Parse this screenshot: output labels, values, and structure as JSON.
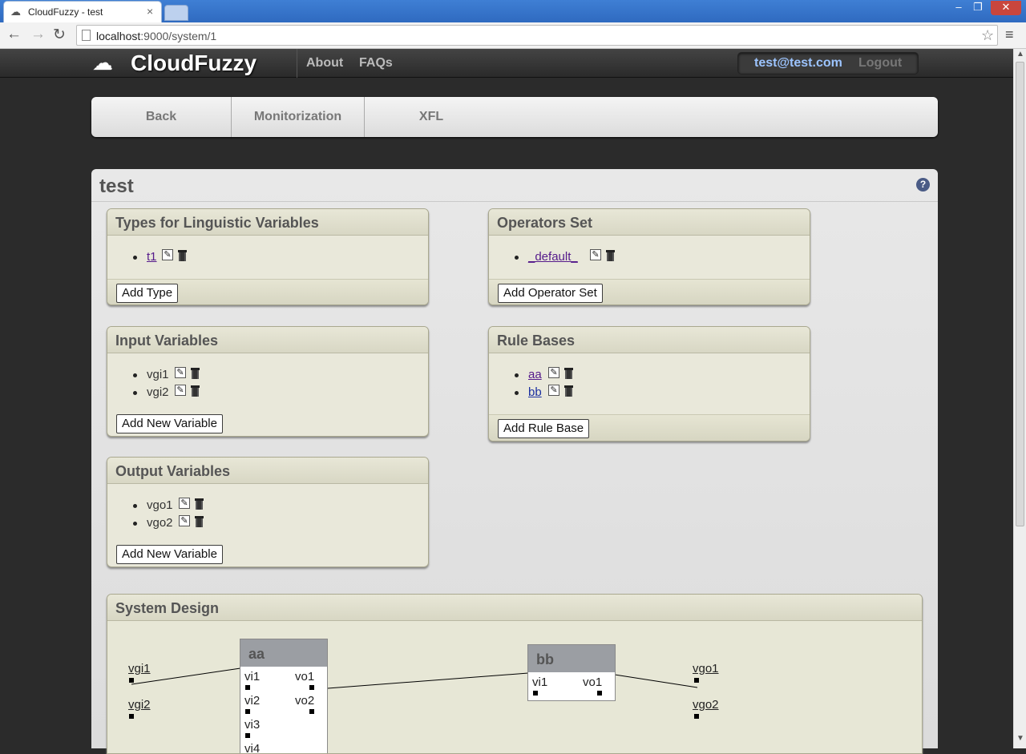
{
  "browser": {
    "tab_title": "CloudFuzzy - test",
    "tab_close": "×",
    "url_host": "localhost",
    "url_path": ":9000/system/1",
    "win_min": "–",
    "win_restore": "❐",
    "win_close": "✕",
    "back": "←",
    "forward": "→",
    "reload": "↻",
    "star": "☆",
    "menu": "≡"
  },
  "header": {
    "brand": "CloudFuzzy",
    "nav": [
      "About",
      "FAQs"
    ],
    "user_email": "test@test.com",
    "logout": "Logout"
  },
  "actions": [
    "Back",
    "Monitorization",
    "XFL"
  ],
  "system": {
    "title": "test",
    "help": "?"
  },
  "types_box": {
    "title": "Types for Linguistic Variables",
    "items": [
      "t1"
    ],
    "button": "Add Type"
  },
  "operators_box": {
    "title": "Operators Set",
    "items": [
      "_default_"
    ],
    "button": "Add Operator Set"
  },
  "inputs_box": {
    "title": "Input Variables",
    "items": [
      "vgi1",
      "vgi2"
    ],
    "button": "Add New Variable"
  },
  "rules_box": {
    "title": "Rule Bases",
    "items": [
      "aa",
      "bb"
    ],
    "button": "Add Rule Base"
  },
  "outputs_box": {
    "title": "Output Variables",
    "items": [
      "vgo1",
      "vgo2"
    ],
    "button": "Add New Variable"
  },
  "design": {
    "title": "System Design",
    "inputs": [
      "vgi1",
      "vgi2"
    ],
    "outputs": [
      "vgo1",
      "vgo2"
    ],
    "modules": [
      {
        "name": "aa",
        "in_ports": [
          "vi1",
          "vi2",
          "vi3",
          "vi4"
        ],
        "out_ports": [
          "vo1",
          "vo2"
        ]
      },
      {
        "name": "bb",
        "in_ports": [
          "vi1"
        ],
        "out_ports": [
          "vo1"
        ]
      }
    ]
  },
  "icons": {
    "edit": "pencil-icon",
    "delete": "trash-icon",
    "edit_glyph": "✎"
  }
}
